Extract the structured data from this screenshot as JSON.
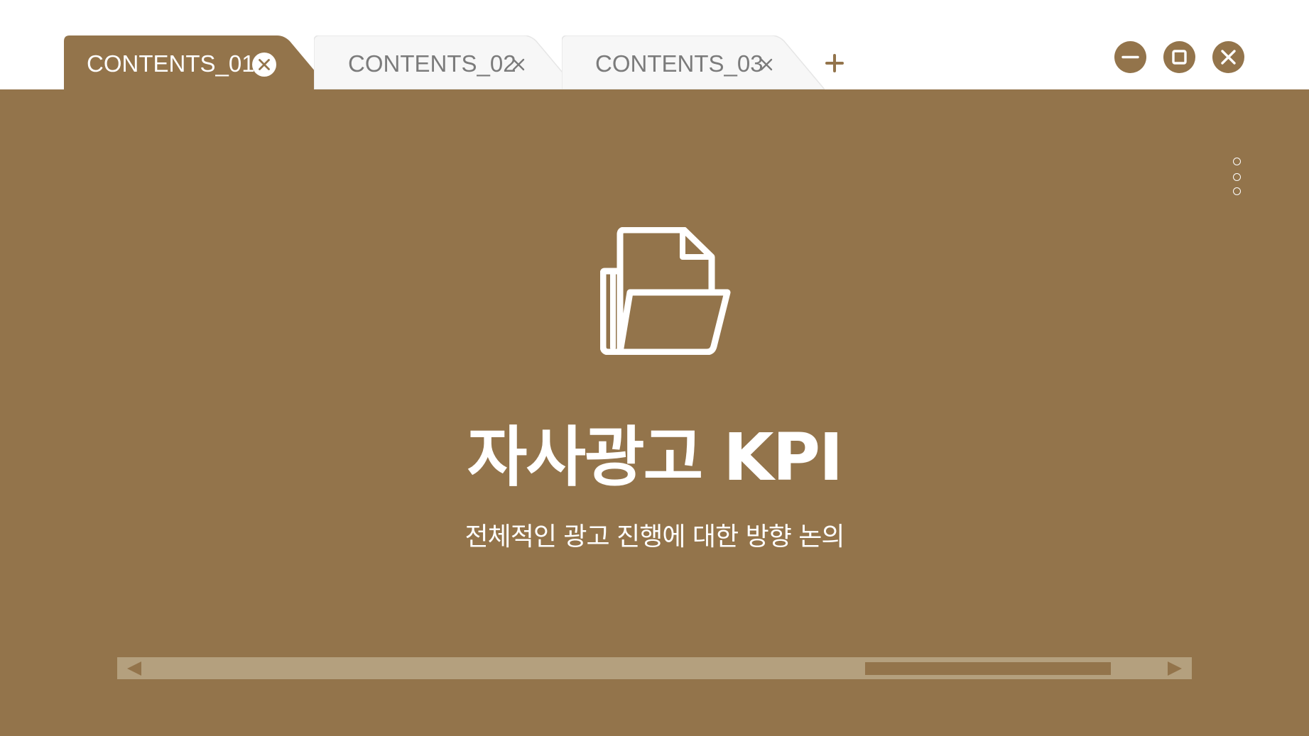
{
  "window": {
    "tabs": [
      {
        "label": "CONTENTS_01",
        "active": true,
        "close_icon": "close-circle-icon"
      },
      {
        "label": "CONTENTS_02",
        "active": false,
        "close_icon": "close-icon"
      },
      {
        "label": "CONTENTS_03",
        "active": false,
        "close_icon": "close-icon"
      }
    ],
    "add_tab_icon": "plus-icon",
    "controls": [
      "minimize-icon",
      "maximize-icon",
      "close-icon"
    ]
  },
  "main": {
    "menu_icon": "vertical-dots-icon",
    "hero_icon": "folder-document-icon",
    "title": "자사광고 KPI",
    "subtitle": "전체적인 광고 진행에 대한 방향 논의"
  },
  "scrollbar": {
    "left_icon": "triangle-left-icon",
    "right_icon": "triangle-right-icon",
    "position": 0.81
  },
  "colors": {
    "accent": "#93744b",
    "track": "#b4a07e",
    "inactive_tab": "#f7f7f7",
    "inactive_text": "#7b7b7b",
    "text_light": "#ffffff"
  }
}
